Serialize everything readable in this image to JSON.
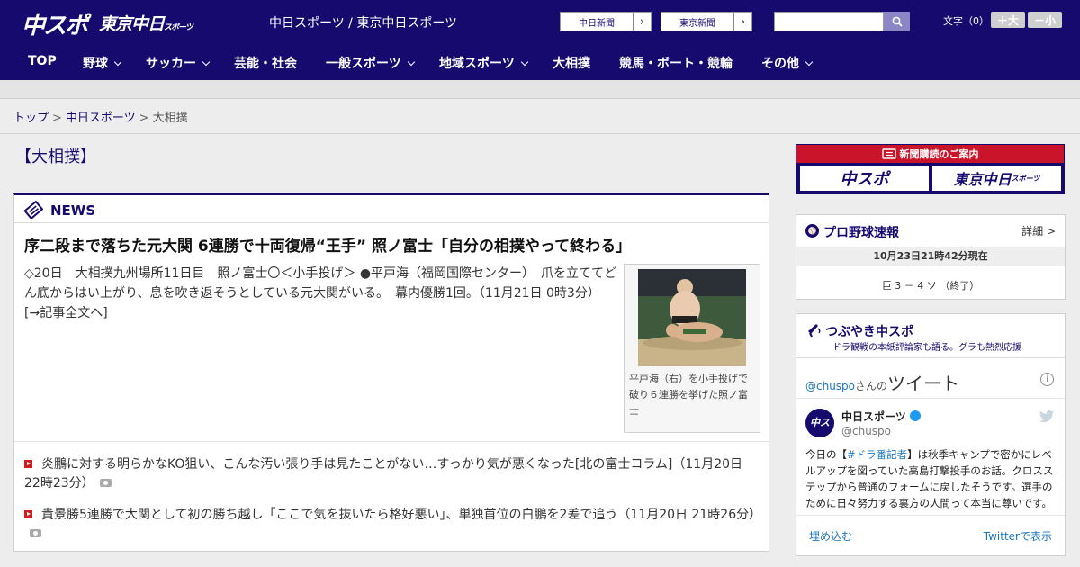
{
  "header": {
    "logo_chuspo": "中スポ",
    "logo_tokyo": "東京中日",
    "logo_tokyo_small": "スポーツ",
    "site_names": "中日スポーツ / 東京中日スポーツ",
    "chunichi_btn": "中日新聞",
    "tokyo_btn": "東京新聞",
    "search_placeholder": "",
    "font_label": "文字（0）",
    "font_plus": "＋大",
    "font_minus": "－小"
  },
  "nav": {
    "items": [
      {
        "label": "TOP"
      },
      {
        "label": "野球"
      },
      {
        "label": "サッカー"
      },
      {
        "label": "芸能・社会"
      },
      {
        "label": "一般スポーツ"
      },
      {
        "label": "地域スポーツ"
      },
      {
        "label": "大相撲"
      },
      {
        "label": "競馬・ボート・競輪"
      },
      {
        "label": "その他"
      }
    ]
  },
  "breadcrumb": {
    "top": "トップ",
    "chunichi": "中日スポーツ",
    "current": "大相撲",
    "sep": ">"
  },
  "page_title": "【大相撲】",
  "news": {
    "section_label": "NEWS",
    "headline": "序二段まで落ちた元大関 6連勝で十両復帰“王手” 照ノ富士「自分の相撲やって終わる」",
    "body": "◇20日　大相撲九州場所11日目　照ノ富士〇＜小手投げ＞ ●平戸海（福岡国際センター）　爪を立ててどん底からはい上がり、息を吹き返そうとしている元大関がいる。　幕内優勝1回。（11月21日 0時3分）　[→記事全文へ]",
    "photo_caption": "平戸海（右）を小手投げで破り６連勝を挙げた照ノ富士",
    "list": [
      {
        "title": "炎鵬に対する明らかなKO狙い、こんな汚い張り手は見たことがない…すっかり気が悪くなった[北の富士コラム]",
        "time": "（11月20日 22時23分）"
      },
      {
        "title": "貴景勝5連勝で大関として初の勝ち越し「ここで気を抜いたら格好悪い」、単独首位の白鵬を2差で追う",
        "time": "（11月20日 21時26分）"
      }
    ]
  },
  "sidebar": {
    "subscribe_label": "新聞購読のご案内",
    "sub_logo_1": "中スポ",
    "sub_logo_2": "東京中日",
    "sub_logo_2_small": "スポーツ",
    "baseball": {
      "title": "プロ野球速報",
      "more": "詳細 >",
      "updated": "10月23日21時42分現在",
      "score": "巨 3 － 4 ソ （終了）"
    },
    "tweets": {
      "title": "つぶやき中スポ",
      "subtitle": "ドラ観戦の本紙評論家も語る。グラも熱烈応援",
      "handle": "@chuspo",
      "handle_suffix": "さんの",
      "tweet_word": "ツイート",
      "info": "i",
      "avatar_text": "中スポ",
      "account_name": "中日スポーツ",
      "account_at": "@chuspo",
      "text_pre": "今日の【",
      "text_tag": "#ドラ番記者",
      "text_post": "】は秋季キャンプで密かにレベルアップを図っていた高島打撃投手のお話。クロスステップから普通のフォームに戻したそうです。選手のために日々努力する裏方の人間って本当に尊いです。",
      "embed": "埋め込む",
      "view_on": "Twitterで表示"
    }
  },
  "colors": {
    "brand_navy": "#160a6e",
    "accent_red": "#c9142a",
    "link_blue": "#1b75bb"
  }
}
